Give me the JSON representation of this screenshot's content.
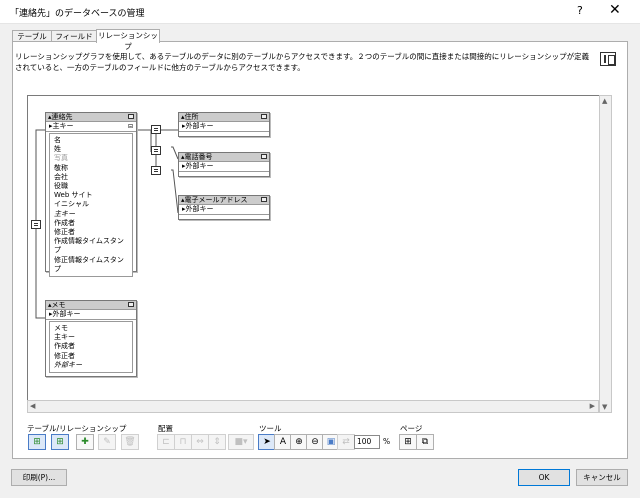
{
  "window": {
    "title": "「連絡先」のデータベースの管理",
    "help": "?",
    "close": "✕"
  },
  "tabs": [
    {
      "label": "テーブル"
    },
    {
      "label": "フィールド"
    },
    {
      "label": "リレーションシップ"
    }
  ],
  "description": "リレーションシップグラフを使用して、あるテーブルのデータに別のテーブルからアクセスできます。２つのテーブルの間に直接または間接的にリレーションシップが定義されていると、一方のテーブルのフィールドに他方のテーブルからアクセスできます。",
  "graph": {
    "tables": {
      "contacts": {
        "name": "連絡先",
        "key": "主キー",
        "fields": [
          "名",
          "姓",
          "写真",
          "敬称",
          "会社",
          "役職",
          "Web サイト",
          "イニシャル",
          "主キー",
          "作成者",
          "修正者",
          "作成情報タイムスタンプ",
          "修正情報タイムスタンプ"
        ]
      },
      "memo": {
        "name": "メモ",
        "key": "外部キー",
        "fields": [
          "メモ",
          "主キー",
          "作成者",
          "修正者",
          "外部キー"
        ]
      },
      "address": {
        "name": "住所",
        "key": "外部キー"
      },
      "phone": {
        "name": "電話番号",
        "key": "外部キー"
      },
      "email": {
        "name": "電子メールアドレス",
        "key": "外部キー"
      }
    }
  },
  "toolbar": {
    "group_table": "テーブル/リレーションシップ",
    "group_arrange": "配置",
    "group_tools": "ツール",
    "group_page": "ページ",
    "zoom_value": "100",
    "zoom_unit": "%"
  },
  "footer": {
    "print_label": "印刷(P)...",
    "ok_label": "OK",
    "cancel_label": "キャンセル"
  }
}
